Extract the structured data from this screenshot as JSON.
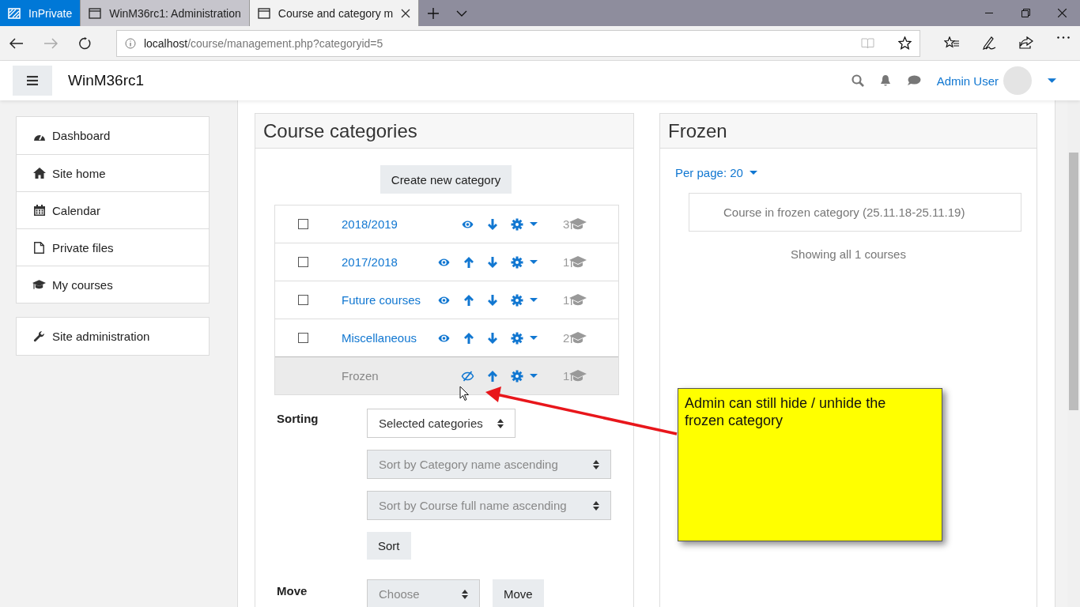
{
  "browser": {
    "tabs": [
      {
        "kind": "private",
        "label": "InPrivate",
        "selected": false
      },
      {
        "kind": "page",
        "label": "WinM36rc1: Administration",
        "selected": false
      },
      {
        "kind": "page",
        "label": "Course and category m",
        "selected": true
      }
    ],
    "url": {
      "host": "localhost",
      "path": "/course/management.php?categoryid=5"
    }
  },
  "navbar": {
    "site_name": "WinM36rc1",
    "user_name": "Admin User"
  },
  "sidebar": {
    "groups": [
      [
        "Dashboard",
        "Site home",
        "Calendar",
        "Private files",
        "My courses"
      ],
      [
        "Site administration"
      ]
    ]
  },
  "categories": {
    "title": "Course categories",
    "create_button": "Create new category",
    "rows": [
      {
        "name": "2018/2019",
        "count": "3",
        "frozen": false,
        "hidden": false,
        "selected": false,
        "move_up": false,
        "move_down": true
      },
      {
        "name": "2017/2018",
        "count": "1",
        "frozen": false,
        "hidden": false,
        "selected": false,
        "move_up": true,
        "move_down": true
      },
      {
        "name": "Future courses",
        "count": "1",
        "frozen": false,
        "hidden": false,
        "selected": false,
        "move_up": true,
        "move_down": true
      },
      {
        "name": "Miscellaneous",
        "count": "2",
        "frozen": false,
        "hidden": false,
        "selected": false,
        "move_up": true,
        "move_down": true
      },
      {
        "name": "Frozen",
        "count": "1",
        "frozen": true,
        "hidden": true,
        "selected": true,
        "move_up": true,
        "move_down": false
      }
    ]
  },
  "sorting": {
    "label": "Sorting",
    "selects": [
      {
        "value": "Selected categories",
        "disabled": false
      },
      {
        "value": "Sort by Category name ascending",
        "disabled": true
      },
      {
        "value": "Sort by Course full name ascending",
        "disabled": true
      }
    ],
    "button": "Sort"
  },
  "move": {
    "label": "Move",
    "select": {
      "value": "Choose",
      "disabled": true
    },
    "button": "Move"
  },
  "frozen_panel": {
    "title": "Frozen",
    "per_page": "Per page: 20",
    "courses": [
      "Course in frozen category (25.11.18-25.11.19)"
    ],
    "summary": "Showing all 1 courses"
  },
  "annotation": {
    "text": "Admin can still hide / unhide the frozen category"
  }
}
